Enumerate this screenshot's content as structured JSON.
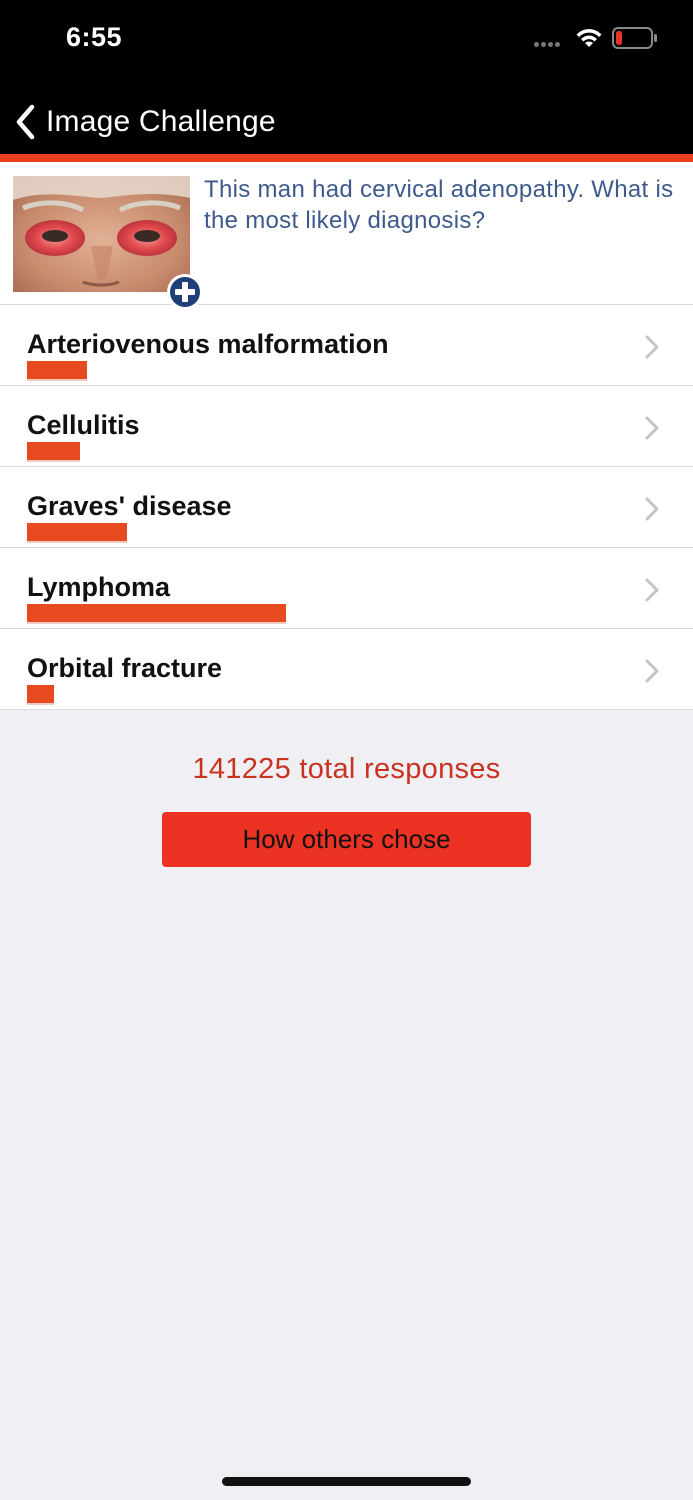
{
  "status_bar": {
    "time": "6:55",
    "battery_color": "#e8322a"
  },
  "nav": {
    "back_label": "Image Challenge"
  },
  "question": {
    "text": "This man had cervical adenopathy. What is the most likely diagnosis?"
  },
  "answers": [
    {
      "label": "Arteriovenous malformation",
      "share_bar": 0.087
    },
    {
      "label": "Cellulitis",
      "share_bar": 0.076
    },
    {
      "label": "Graves' disease",
      "share_bar": 0.144
    },
    {
      "label": "Lymphoma",
      "share_bar": 0.374
    },
    {
      "label": "Orbital fracture",
      "share_bar": 0.039
    }
  ],
  "footer": {
    "total_responses": "141225 total responses",
    "others_button": "How others chose"
  },
  "colors": {
    "accent": "#e8401f",
    "question_text": "#3e5a8c",
    "button": "#ec3222"
  }
}
